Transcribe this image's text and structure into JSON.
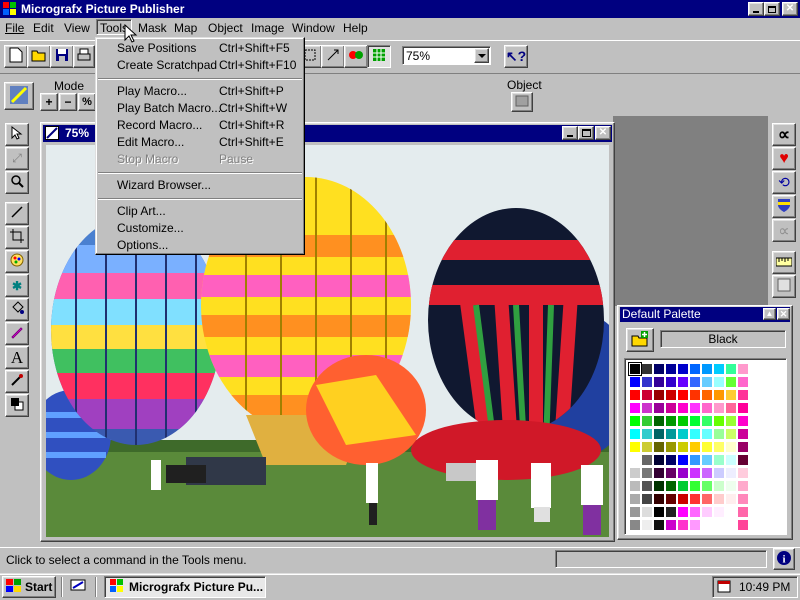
{
  "app": {
    "title": "Micrografx Picture Publisher",
    "menus": [
      "File",
      "Edit",
      "View",
      "Tools",
      "Mask",
      "Map",
      "Object",
      "Image",
      "Window",
      "Help"
    ]
  },
  "toolbar": {
    "zoom_value": "75%"
  },
  "mode_panel": {
    "label": "Mode"
  },
  "object_panel": {
    "label": "Object"
  },
  "document": {
    "title": "75%"
  },
  "tools_menu": {
    "groups": [
      [
        {
          "label": "Save Positions",
          "shortcut": "Ctrl+Shift+F5",
          "enabled": true
        },
        {
          "label": "Create Scratchpad",
          "shortcut": "Ctrl+Shift+F10",
          "enabled": true
        }
      ],
      [
        {
          "label": "Play Macro...",
          "shortcut": "Ctrl+Shift+P",
          "enabled": true
        },
        {
          "label": "Play Batch Macro...",
          "shortcut": "Ctrl+Shift+W",
          "enabled": true
        },
        {
          "label": "Record Macro...",
          "shortcut": "Ctrl+Shift+R",
          "enabled": true
        },
        {
          "label": "Edit Macro...",
          "shortcut": "Ctrl+Shift+E",
          "enabled": true
        },
        {
          "label": "Stop Macro",
          "shortcut": "Pause",
          "enabled": false
        }
      ],
      [
        {
          "label": "Wizard Browser...",
          "shortcut": "",
          "enabled": true
        }
      ],
      [
        {
          "label": "Clip Art...",
          "shortcut": "",
          "enabled": true
        },
        {
          "label": "Customize...",
          "shortcut": "",
          "enabled": true
        },
        {
          "label": "Options...",
          "shortcut": "",
          "enabled": true
        }
      ]
    ]
  },
  "palette": {
    "title": "Default Palette",
    "selected_color_name": "Black",
    "columns": [
      [
        "#000000",
        "#0000ff",
        "#ff0000",
        "#ff00ff",
        "#00ff00",
        "#00ffff",
        "#ffff00",
        "#ffffff",
        "#cccccc",
        "#bbbbbb",
        "#aaaaaa",
        "#999999",
        "#888888"
      ],
      [
        "#333333",
        "#3333cc",
        "#cc0033",
        "#cc33cc",
        "#33cc33",
        "#33cccc",
        "#cccc33",
        "#666666",
        "#777777",
        "#555555",
        "#444444",
        "#dddddd",
        "#eeeeee"
      ],
      [
        "#000066",
        "#330099",
        "#990000",
        "#990099",
        "#006600",
        "#006666",
        "#666600",
        "#000033",
        "#330033",
        "#003300",
        "#330000",
        "#000000",
        "#111111"
      ],
      [
        "#000099",
        "#3300cc",
        "#cc0000",
        "#cc0099",
        "#009900",
        "#009999",
        "#999900",
        "#000066",
        "#660066",
        "#006600",
        "#660000",
        "#222222",
        "#cc00cc"
      ],
      [
        "#0000cc",
        "#6600ff",
        "#ff0000",
        "#ff00cc",
        "#00cc00",
        "#00cccc",
        "#cccc00",
        "#0000ff",
        "#9900cc",
        "#00cc33",
        "#cc0000",
        "#ff00ff",
        "#ff33cc"
      ],
      [
        "#0066ff",
        "#3366ff",
        "#ff3300",
        "#ff33ff",
        "#00ff33",
        "#33ffff",
        "#ffcc00",
        "#3399ff",
        "#cc33ff",
        "#33ff33",
        "#ff3333",
        "#ff66ff",
        "#ff99ff"
      ],
      [
        "#0099ff",
        "#66ccff",
        "#ff6600",
        "#ff66cc",
        "#33ff66",
        "#66ffff",
        "#ffff33",
        "#66ccff",
        "#cc66ff",
        "#66ff66",
        "#ff6666",
        "#ffccff",
        "#ffffff"
      ],
      [
        "#00ccff",
        "#99ffff",
        "#ff9900",
        "#ff99cc",
        "#66ff00",
        "#99ff99",
        "#ffff66",
        "#99ffcc",
        "#ccccff",
        "#ccffcc",
        "#ffcccc",
        "#ffeeff",
        "#ffffff"
      ],
      [
        "#33ff99",
        "#66ff33",
        "#ffcc33",
        "#ff6699",
        "#99ff33",
        "#ccff66",
        "#ffffcc",
        "#ccffff",
        "#eeeeff",
        "#eeffee",
        "#ffeeee",
        "#ffffff",
        "#ffffff"
      ],
      [
        "#ff99cc",
        "#ff66cc",
        "#ff3399",
        "#ff0099",
        "#ff00cc",
        "#cc0099",
        "#990066",
        "#660033",
        "#ffccdd",
        "#ffaacc",
        "#ff88bb",
        "#ff66aa",
        "#ff4499"
      ]
    ]
  },
  "status": {
    "message": "Click to select a command in the Tools menu."
  },
  "taskbar": {
    "start_label": "Start",
    "task_label": "Micrografx Picture Pu...",
    "clock": "10:49 PM"
  }
}
